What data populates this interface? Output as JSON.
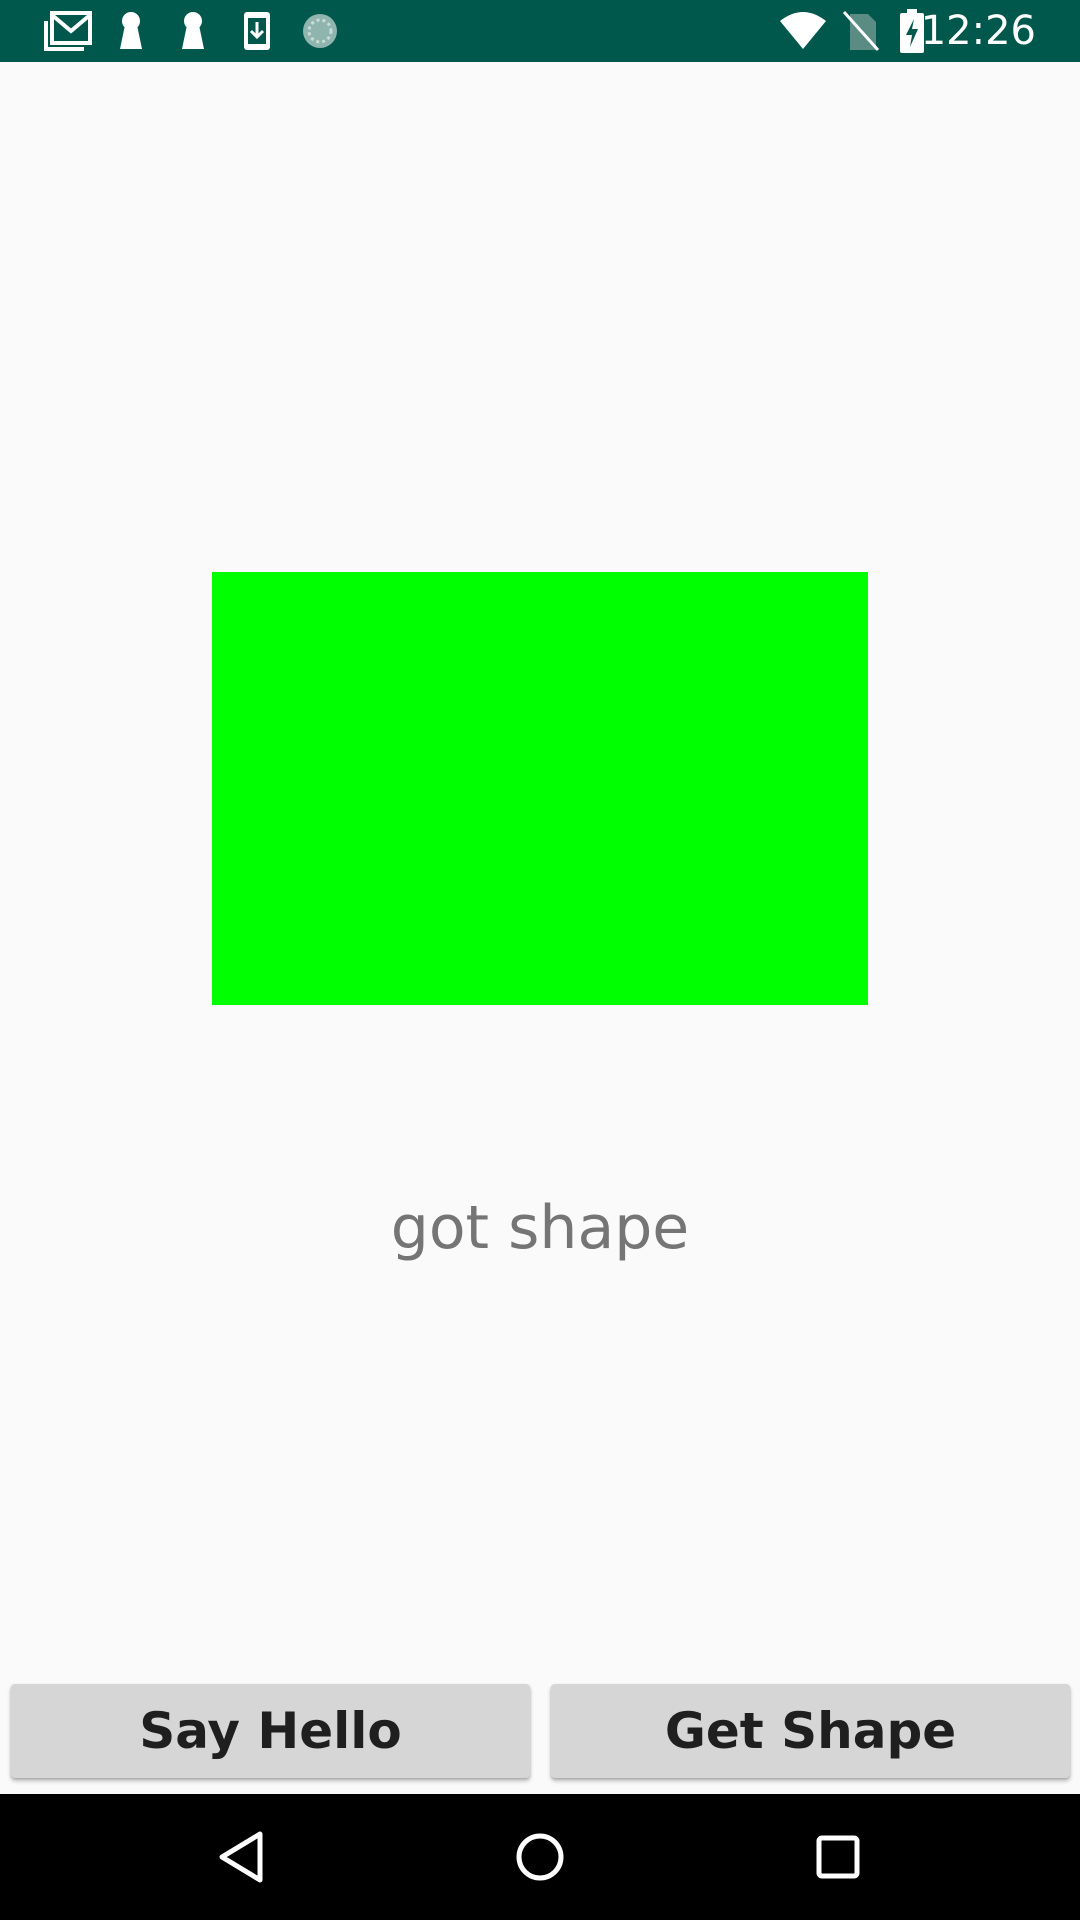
{
  "status_bar": {
    "time": "12:26",
    "background": "#00574b",
    "left_icons": [
      "gmail-icon",
      "keyhole-icon",
      "keyhole-icon",
      "download-icon",
      "sync-icon"
    ],
    "right_icons": [
      "wifi-icon",
      "no-sim-icon",
      "battery-charging-icon"
    ]
  },
  "main": {
    "shape_color": "#00ff00",
    "shape_label": "got shape"
  },
  "buttons": {
    "say_hello": "Say Hello",
    "get_shape": "Get Shape"
  },
  "nav_bar": {
    "items": [
      "back-icon",
      "home-icon",
      "recents-icon"
    ]
  }
}
